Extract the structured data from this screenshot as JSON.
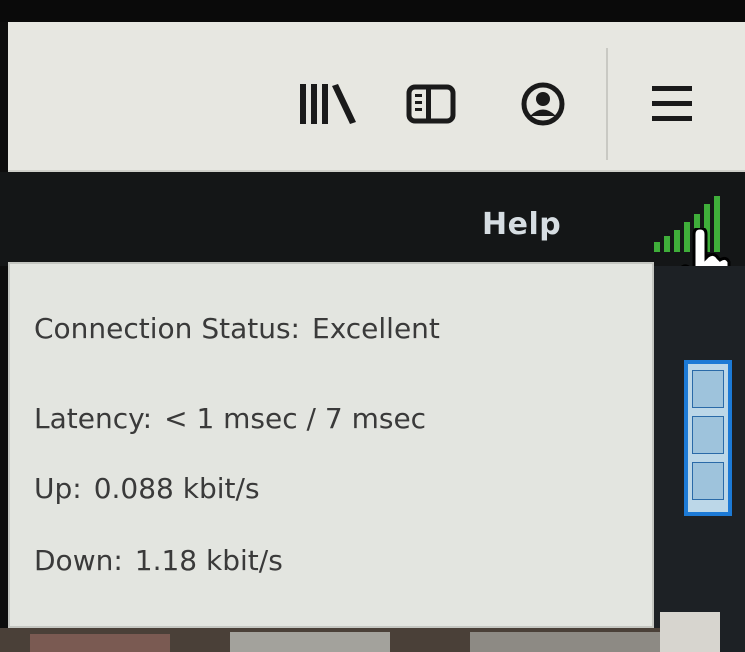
{
  "toolbar": {
    "icons": [
      "library-icon",
      "sidebar-icon",
      "account-icon",
      "menu-icon"
    ]
  },
  "appbar": {
    "help_label": "Help",
    "signal_icon": "signal-strength-icon",
    "cursor_icon": "hand-pointer-icon"
  },
  "tooltip": {
    "status_label": "Connection Status:",
    "status_value": "Excellent",
    "latency_label": "Latency:",
    "latency_value": "< 1 msec / 7 msec",
    "up_label": "Up:",
    "up_value": "0.088 kbit/s",
    "down_label": "Down:",
    "down_value": "1.18 kbit/s"
  },
  "colors": {
    "toolbar_bg": "#e7e7e1",
    "appbar_bg": "#141617",
    "tooltip_bg": "#e3e5e0",
    "signal_green": "#3fae3a",
    "accent_blue": "#1c7ad6"
  }
}
